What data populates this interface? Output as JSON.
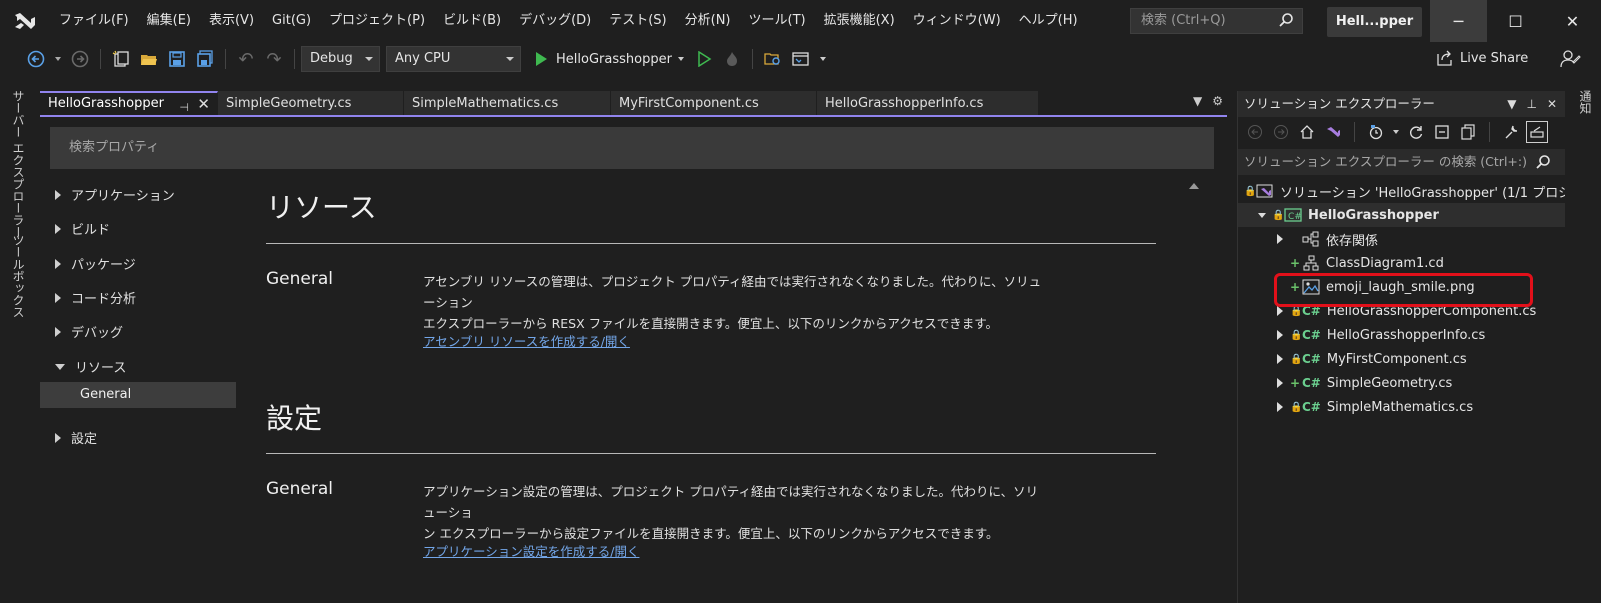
{
  "menu": {
    "items": [
      "ファイル(F)",
      "編集(E)",
      "表示(V)",
      "Git(G)",
      "プロジェクト(P)",
      "ビルド(B)",
      "デバッグ(D)",
      "テスト(S)",
      "分析(N)",
      "ツール(T)",
      "拡張機能(X)",
      "ウィンドウ(W)",
      "ヘルプ(H)"
    ],
    "search_placeholder": "検索 (Ctrl+Q)",
    "window_title": "Hell...pper"
  },
  "toolbar": {
    "configuration": "Debug",
    "platform": "Any CPU",
    "run_target": "HelloGrasshopper",
    "live_share": "Live Share"
  },
  "side_tabs": {
    "left": [
      "サーバー エクスプローラー",
      "ツールボックス"
    ],
    "right": [
      "通知"
    ]
  },
  "tabs": [
    {
      "label": "HelloGrasshopper",
      "active": true
    },
    {
      "label": "SimpleGeometry.cs",
      "active": false
    },
    {
      "label": "SimpleMathematics.cs",
      "active": false
    },
    {
      "label": "MyFirstComponent.cs",
      "active": false
    },
    {
      "label": "HelloGrasshopperInfo.cs",
      "active": false
    }
  ],
  "properties": {
    "search_placeholder": "検索プロパティ",
    "nav": [
      {
        "label": "アプリケーション",
        "expanded": false
      },
      {
        "label": "ビルド",
        "expanded": false
      },
      {
        "label": "パッケージ",
        "expanded": false
      },
      {
        "label": "コード分析",
        "expanded": false
      },
      {
        "label": "デバッグ",
        "expanded": false
      },
      {
        "label": "リソース",
        "expanded": true
      },
      {
        "label": "General",
        "selected": true
      },
      {
        "label": "設定",
        "expanded": false
      }
    ],
    "sections": [
      {
        "title": "リソース",
        "subheading": "General",
        "description_line1": "アセンブリ リソースの管理は、プロジェクト プロパティ経由では実行されなくなりました。代わりに、ソリューション",
        "description_line2": "エクスプローラーから RESX ファイルを直接開きます。便宜上、以下のリンクからアクセスできます。",
        "link": "アセンブリ リソースを作成する/開く"
      },
      {
        "title": "設定",
        "subheading": "General",
        "description_line1": "アプリケーション設定の管理は、プロジェクト プロパティ経由では実行されなくなりました。代わりに、ソリューショ",
        "description_line2": "ン エクスプローラーから設定ファイルを直接開きます。便宜上、以下のリンクからアクセスできます。",
        "link": "アプリケーション設定を作成する/開く"
      }
    ]
  },
  "solution_explorer": {
    "title": "ソリューション エクスプローラー",
    "search_placeholder": "ソリューション エクスプローラー の検索 (Ctrl+:)",
    "tree": [
      {
        "label": "ソリューション 'HelloGrasshopper' (1/1 プロジェ",
        "icon": "solution-icon"
      },
      {
        "label": "HelloGrasshopper",
        "icon": "csproj-icon",
        "bold": true
      },
      {
        "label": "依存関係",
        "icon": "dependencies-icon"
      },
      {
        "label": "ClassDiagram1.cd",
        "icon": "class-diagram-icon"
      },
      {
        "label": "emoji_laugh_smile.png",
        "icon": "image-file-icon",
        "highlighted": true
      },
      {
        "label": "HelloGrasshopperComponent.cs",
        "icon": "csharp-file-icon"
      },
      {
        "label": "HelloGrasshopperInfo.cs",
        "icon": "csharp-file-icon"
      },
      {
        "label": "MyFirstComponent.cs",
        "icon": "csharp-file-icon"
      },
      {
        "label": "SimpleGeometry.cs",
        "icon": "csharp-file-icon"
      },
      {
        "label": "SimpleMathematics.cs",
        "icon": "csharp-file-icon"
      }
    ]
  },
  "colors": {
    "background": "#1f1f1f",
    "accent": "#9184ee",
    "link": "#73a6e8",
    "highlight_border": "#e2101a",
    "csharp_green": "#6bcf8f"
  }
}
